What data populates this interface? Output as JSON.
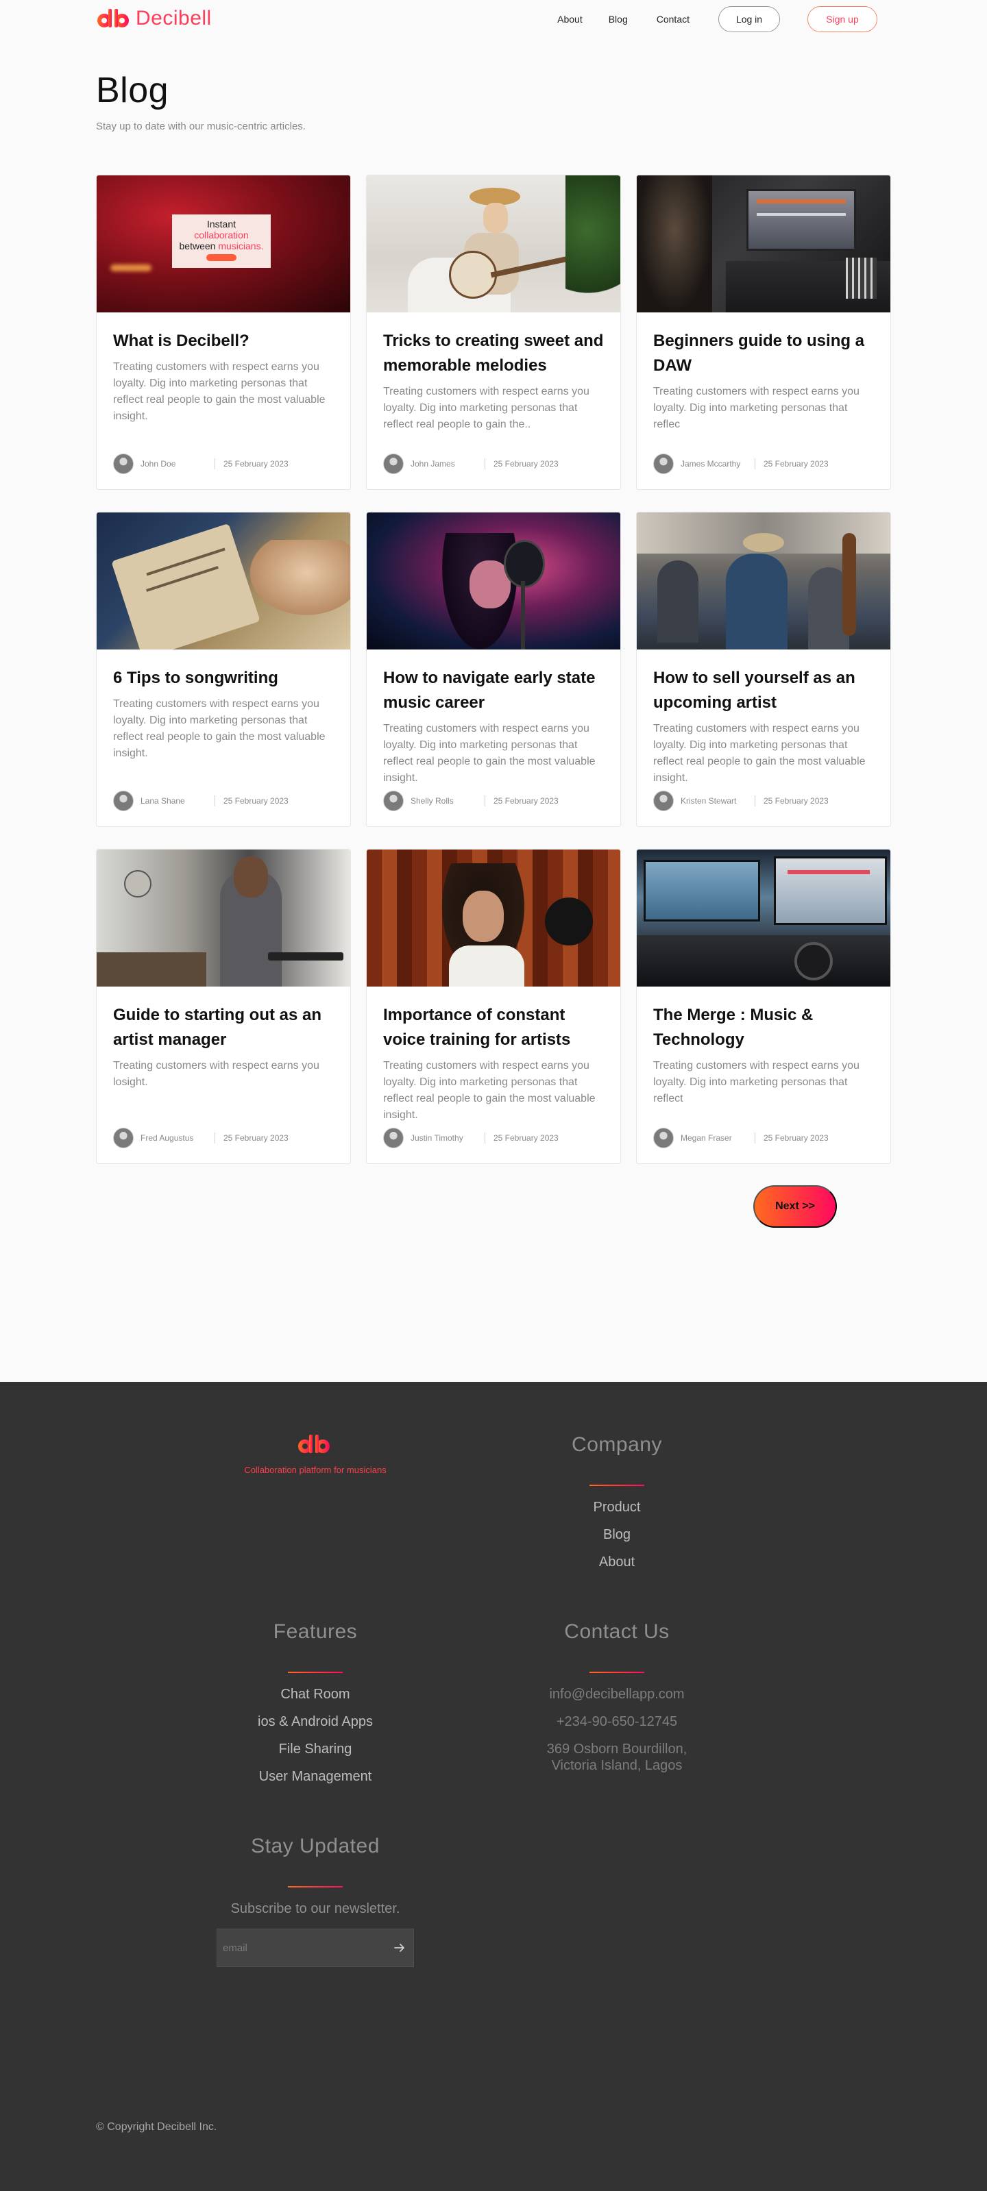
{
  "nav": {
    "brand": "Decibell",
    "links": [
      "About",
      "Blog",
      "Contact"
    ],
    "login_label": "Log in",
    "signup_label": "Sign up"
  },
  "header": {
    "title": "Blog",
    "subtitle": "Stay up to date with  our music-centric articles."
  },
  "image_panel": {
    "line1": "Instant",
    "line2": "collaboration",
    "line3a": "between",
    "line3b": "musicians."
  },
  "posts": [
    {
      "title": "What is Decibell?",
      "excerpt": "Treating customers with respect earns you loyalty. Dig into marketing personas that reflect real people to gain the most valuable insight.",
      "author": "John Doe",
      "date": "25 February 2023"
    },
    {
      "title": "Tricks to creating sweet and memorable melodies",
      "excerpt": "Treating customers with respect earns you loyalty. Dig into marketing personas that reflect real people to gain the..",
      "author": "John James",
      "date": "25 February 2023"
    },
    {
      "title": "Beginners guide to using a DAW",
      "excerpt": "Treating customers with respect earns you loyalty. Dig into marketing personas that reflec",
      "author": "James Mccarthy",
      "date": "25 February 2023"
    },
    {
      "title": "6 Tips to songwriting",
      "excerpt": "Treating customers with respect earns you loyalty. Dig into marketing personas that reflect real people to gain the most valuable insight.",
      "author": "Lana Shane",
      "date": "25 February 2023"
    },
    {
      "title": "How to navigate early state music career",
      "excerpt": "Treating customers with respect earns you loyalty. Dig into marketing personas that reflect real people to gain the most valuable insight.",
      "author": "Shelly Rolls",
      "date": "25 February 2023"
    },
    {
      "title": "How to sell yourself as an upcoming artist",
      "excerpt": "Treating customers with respect earns you loyalty. Dig into marketing personas that reflect real people to gain the most valuable insight.",
      "author": "Kristen Stewart",
      "date": "25 February 2023"
    },
    {
      "title": "Guide to starting out as an artist manager",
      "excerpt": "Treating customers with respect earns you losight.",
      "author": "Fred Augustus",
      "date": "25 February 2023"
    },
    {
      "title": "Importance of constant voice training for artists",
      "excerpt": "Treating customers with respect earns you loyalty. Dig into marketing personas that reflect real people to gain the most valuable insight.",
      "author": "Justin Timothy",
      "date": "25 February 2023"
    },
    {
      "title": "The Merge : Music & Technology",
      "excerpt": "Treating customers with respect earns you loyalty. Dig into marketing personas that reflect",
      "author": "Megan Fraser",
      "date": "25 February 2023"
    }
  ],
  "pagination": {
    "next_label": "Next >>"
  },
  "footer": {
    "tagline": "Collaboration platform for musicians",
    "company": {
      "heading": "Company",
      "items": [
        "Product",
        "Blog",
        "About"
      ]
    },
    "features": {
      "heading": "Features",
      "items": [
        "Chat Room",
        "ios & Android Apps",
        "File Sharing",
        "User Management"
      ]
    },
    "contact": {
      "heading": "Contact Us",
      "email": "info@decibellapp.com",
      "phone": "+234-90-650-12745",
      "address_line1": "369 Osborn Bourdillon,",
      "address_line2": "Victoria Island, Lagos"
    },
    "newsletter": {
      "heading": "Stay Updated",
      "text": "Subscribe to our newsletter.",
      "placeholder": "email"
    },
    "copyright": "© Copyright Decibell Inc."
  },
  "colors": {
    "brand_gradient_start": "#ff6a1e",
    "brand_gradient_end": "#ff0a5e",
    "brand_text": "#ff3d5a",
    "footer_bg": "#343333"
  },
  "icons": {
    "logo": "decibell-logo-icon",
    "submit": "arrow-right-icon",
    "avatar": "user-avatar-icon"
  }
}
